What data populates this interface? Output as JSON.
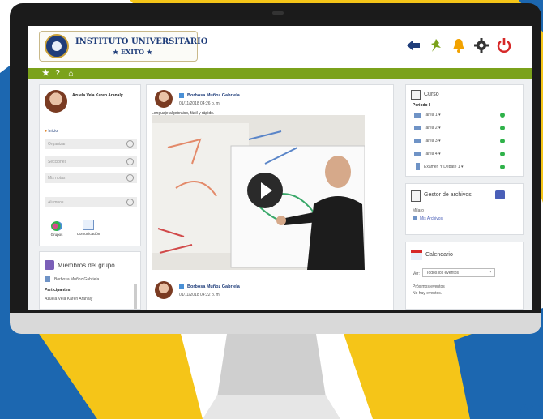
{
  "header": {
    "logo_line1": "INSTITUTO UNIVERSITARIO",
    "logo_line2": "★ EXITO ★",
    "icons": [
      "arrow-left-icon",
      "pin-icon",
      "bell-icon",
      "gear-icon",
      "power-icon"
    ]
  },
  "greenbar": {
    "icons": [
      "star-icon",
      "help-icon",
      "home-icon"
    ],
    "star": "★",
    "help": "?",
    "home": "⌂"
  },
  "profile": {
    "name": "Azuela Vela Karen Aranaly",
    "inicio": "Inicio",
    "rows": [
      "Organizar",
      "Secciones",
      "Mis notas"
    ],
    "alumnos": "Alumnos",
    "grupos": "Grupos",
    "comunicacion": "Comunicación"
  },
  "members": {
    "title": "Miembros del grupo",
    "teacher": "Borbosa Muñoz Gabriela",
    "participantes": "Participantes",
    "student": "Azuela Vela Karen Aranaly"
  },
  "post1": {
    "author": "Borbosa Muñoz Gabriela",
    "date": "01/11/2018 04:26 p. m.",
    "text": "Lenguaje algebraico, fácil y rápido."
  },
  "post2": {
    "author": "Borbosa Muñoz Gabriela",
    "date": "01/11/2018 04:22 p. m."
  },
  "curso": {
    "title": "Curso",
    "periodo": "Periodo I",
    "items": [
      "Tarea 1 ▾",
      "Tarea 2 ▾",
      "Tarea 3 ▾",
      "Tarea 4 ▾",
      "Examen Y Debate 1 ▾"
    ]
  },
  "gestor": {
    "title": "Gestor de archivos",
    "sub": "Miíaro",
    "link": "Mis Archivos"
  },
  "calendario": {
    "title": "Calendario",
    "ver_label": "Ver:",
    "select_value": "Todos los eventos",
    "proximos": "Próximos eventos",
    "no_events": "No hay eventos."
  },
  "colors": {
    "accent_green": "#7ba21b",
    "brand_blue": "#1f3d7a",
    "status_green": "#2fb24a",
    "bell": "#f2a200",
    "power": "#d62828"
  }
}
